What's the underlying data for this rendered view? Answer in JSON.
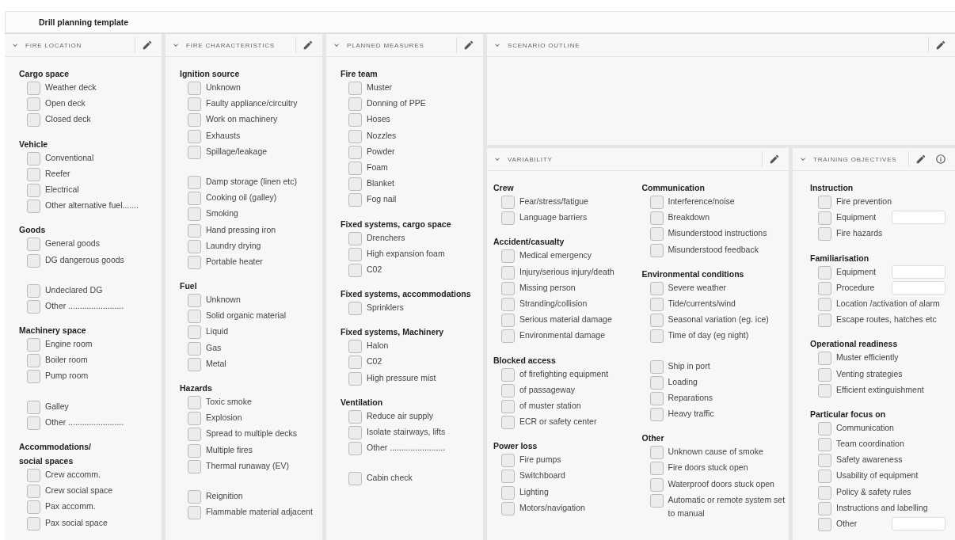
{
  "page_title": "Drill planning template",
  "panels": [
    {
      "title": "FIRE LOCATION",
      "expanded": true,
      "editable": true,
      "has_info": false,
      "columns": [
        [
          {
            "heading": "Cargo space",
            "items": [
              {
                "label": "Weather deck",
                "checked": false
              },
              {
                "label": "Open deck",
                "checked": false
              },
              {
                "label": "Closed deck",
                "checked": false
              }
            ]
          },
          {
            "heading": "Vehicle",
            "items": [
              {
                "label": "Conventional",
                "checked": false
              },
              {
                "label": "Reefer",
                "checked": false
              },
              {
                "label": "Electrical",
                "checked": false
              },
              {
                "label": "Other alternative fuel.......",
                "checked": false
              }
            ]
          },
          {
            "heading": "Goods",
            "items": [
              {
                "label": "General goods",
                "checked": false
              },
              {
                "label": "DG dangerous goods",
                "checked": false
              }
            ]
          },
          {
            "items": [
              {
                "label": "Undeclared DG",
                "checked": false
              },
              {
                "label": "Other ........................",
                "checked": false
              }
            ]
          },
          {
            "heading": "Machinery space",
            "items": [
              {
                "label": "Engine room",
                "checked": false
              },
              {
                "label": "Boiler room",
                "checked": false
              },
              {
                "label": "Pump room",
                "checked": false
              }
            ]
          },
          {
            "items": [
              {
                "label": "Galley",
                "checked": false
              },
              {
                "label": "Other ........................",
                "checked": false
              }
            ]
          },
          {
            "heading": "Accommodations/\nsocial spaces",
            "items": [
              {
                "label": "Crew accomm.",
                "checked": false
              },
              {
                "label": "Crew social space",
                "checked": false
              },
              {
                "label": "Pax accomm.",
                "checked": false
              },
              {
                "label": "Pax social space",
                "checked": false
              }
            ]
          }
        ]
      ]
    },
    {
      "title": "FIRE CHARACTERISTICS",
      "expanded": true,
      "editable": true,
      "has_info": false,
      "columns": [
        [
          {
            "heading": "Ignition source",
            "items": [
              {
                "label": "Unknown",
                "checked": false
              },
              {
                "label": "Faulty appliance/circuitry",
                "checked": false
              },
              {
                "label": "Work on machinery",
                "checked": false
              },
              {
                "label": "Exhausts",
                "checked": false
              },
              {
                "label": "Spillage/leakage",
                "checked": false
              }
            ]
          },
          {
            "items": [
              {
                "label": "Damp storage (linen etc)",
                "checked": false
              },
              {
                "label": "Cooking oil (galley)",
                "checked": false
              },
              {
                "label": "Smoking",
                "checked": false
              },
              {
                "label": "Hand pressing iron",
                "checked": false
              },
              {
                "label": "Laundry drying",
                "checked": false
              },
              {
                "label": "Portable heater",
                "checked": false
              }
            ]
          },
          {
            "heading": "Fuel",
            "items": [
              {
                "label": "Unknown",
                "checked": false
              },
              {
                "label": "Solid organic material",
                "checked": false
              },
              {
                "label": "Liquid",
                "checked": false
              },
              {
                "label": "Gas",
                "checked": false
              },
              {
                "label": "Metal",
                "checked": false
              }
            ]
          },
          {
            "heading": "Hazards",
            "items": [
              {
                "label": "Toxic smoke",
                "checked": false
              },
              {
                "label": "Explosion",
                "checked": false
              },
              {
                "label": "Spread to multiple decks",
                "checked": false
              },
              {
                "label": "Multiple fires",
                "checked": false
              },
              {
                "label": "Thermal runaway (EV)",
                "checked": false
              }
            ]
          },
          {
            "items": [
              {
                "label": "Reignition",
                "checked": false
              },
              {
                "label": "Flammable material adjacent",
                "checked": false
              }
            ]
          }
        ]
      ]
    },
    {
      "title": "PLANNED MEASURES",
      "expanded": true,
      "editable": true,
      "has_info": false,
      "columns": [
        [
          {
            "heading": "Fire team",
            "items": [
              {
                "label": "Muster",
                "checked": false
              },
              {
                "label": "Donning of PPE",
                "checked": false
              },
              {
                "label": "Hoses",
                "checked": false
              },
              {
                "label": "Nozzles",
                "checked": false
              },
              {
                "label": "Powder",
                "checked": false
              },
              {
                "label": "Foam",
                "checked": false
              },
              {
                "label": "Blanket",
                "checked": false
              },
              {
                "label": "Fog nail",
                "checked": false
              }
            ]
          },
          {
            "heading": "Fixed systems, cargo space",
            "items": [
              {
                "label": "Drenchers",
                "checked": false
              },
              {
                "label": "High expansion foam",
                "checked": false
              },
              {
                "label": "C02",
                "checked": false
              }
            ]
          },
          {
            "heading": "Fixed systems, accommodations",
            "items": [
              {
                "label": "Sprinklers",
                "checked": false
              }
            ]
          },
          {
            "heading": "Fixed systems, Machinery",
            "items": [
              {
                "label": "Halon",
                "checked": false
              },
              {
                "label": "C02",
                "checked": false
              },
              {
                "label": "High pressure mist",
                "checked": false
              }
            ]
          },
          {
            "heading": "Ventilation",
            "items": [
              {
                "label": "Reduce air supply",
                "checked": false
              },
              {
                "label": "Isolate stairways, lifts",
                "checked": false
              },
              {
                "label": "Other ........................",
                "checked": false
              }
            ]
          },
          {
            "items": [
              {
                "label": "Cabin check",
                "checked": false
              }
            ]
          }
        ]
      ]
    },
    {
      "title": "SCENARIO OUTLINE",
      "expanded": true,
      "editable": true,
      "has_info": false
    },
    {
      "title": "VARIABILITY",
      "expanded": true,
      "editable": true,
      "has_info": false,
      "columns": [
        [
          {
            "heading": "Crew",
            "items": [
              {
                "label": "Fear/stress/fatigue",
                "checked": false
              },
              {
                "label": "Language barriers",
                "checked": false
              }
            ]
          },
          {
            "heading": "Accident/casualty",
            "items": [
              {
                "label": "Medical emergency",
                "checked": false
              },
              {
                "label": "Injury/serious injury/death",
                "checked": false
              },
              {
                "label": "Missing person",
                "checked": false
              },
              {
                "label": "Stranding/collision",
                "checked": false
              },
              {
                "label": "Serious material damage",
                "checked": false
              },
              {
                "label": "Environmental damage",
                "checked": false
              }
            ]
          },
          {
            "heading": "Blocked access",
            "items": [
              {
                "label": "of firefighting equipment",
                "checked": false
              },
              {
                "label": "of passageway",
                "checked": false
              },
              {
                "label": "of muster station",
                "checked": false
              },
              {
                "label": "ECR or safety center",
                "checked": false
              }
            ]
          },
          {
            "heading": "Power loss",
            "items": [
              {
                "label": "Fire pumps",
                "checked": false
              },
              {
                "label": "Switchboard",
                "checked": false
              },
              {
                "label": "Lighting",
                "checked": false
              },
              {
                "label": "Motors/navigation",
                "checked": false
              }
            ]
          }
        ],
        [
          {
            "heading": "Communication",
            "items": [
              {
                "label": "Interference/noise",
                "checked": false
              },
              {
                "label": "Breakdown",
                "checked": false
              },
              {
                "label": "Misunderstood instructions",
                "checked": false
              },
              {
                "label": "Misunderstood feedback",
                "checked": false
              }
            ]
          },
          {
            "heading": "Environmental conditions",
            "items": [
              {
                "label": "Severe weather",
                "checked": false
              },
              {
                "label": "Tide/currents/wind",
                "checked": false
              },
              {
                "label": "Seasonal variation (eg. ice)",
                "checked": false
              },
              {
                "label": "Time of day (eg night)",
                "checked": false
              }
            ]
          },
          {
            "items": [
              {
                "label": "Ship in port",
                "checked": false
              },
              {
                "label": "Loading",
                "checked": false
              },
              {
                "label": "Reparations",
                "checked": false
              },
              {
                "label": "Heavy traffic",
                "checked": false
              }
            ]
          },
          {
            "heading": "Other",
            "items": [
              {
                "label": "Unknown cause of smoke",
                "checked": false
              },
              {
                "label": "Fire doors stuck open",
                "checked": false
              },
              {
                "label": "Waterproof doors stuck open",
                "checked": false
              },
              {
                "label": "Automatic or remote system set to manual",
                "checked": false
              }
            ]
          }
        ]
      ]
    },
    {
      "title": "TRAINING OBJECTIVES",
      "expanded": true,
      "editable": true,
      "has_info": true,
      "columns": [
        [
          {
            "heading": "Instruction",
            "items": [
              {
                "label": "Fire prevention",
                "checked": false
              },
              {
                "label": "Equipment",
                "checked": false,
                "kind": "with_field"
              },
              {
                "label": "Fire hazards",
                "checked": false
              }
            ]
          },
          {
            "heading": "Familiarisation",
            "items": [
              {
                "label": "Equipment",
                "checked": false,
                "kind": "with_field"
              },
              {
                "label": "Procedure",
                "checked": false,
                "kind": "with_field"
              },
              {
                "label": "Location /activation of alarm",
                "checked": false
              },
              {
                "label": "Escape routes, hatches etc",
                "checked": false
              }
            ]
          },
          {
            "heading": "Operational readiness",
            "items": [
              {
                "label": "Muster efficiently",
                "checked": false
              },
              {
                "label": "Venting strategies",
                "checked": false
              },
              {
                "label": "Efficient extinguishment",
                "checked": false
              }
            ]
          },
          {
            "heading": "Particular focus on",
            "items": [
              {
                "label": "Communication",
                "checked": false
              },
              {
                "label": "Team coordination",
                "checked": false
              },
              {
                "label": "Safety awareness",
                "checked": false
              },
              {
                "label": "Usability of equipment",
                "checked": false
              },
              {
                "label": "Policy & safety rules",
                "checked": false
              },
              {
                "label": "Instructions and labelling",
                "checked": false
              },
              {
                "label": "Other",
                "checked": false,
                "kind": "with_field"
              }
            ]
          }
        ]
      ]
    }
  ]
}
